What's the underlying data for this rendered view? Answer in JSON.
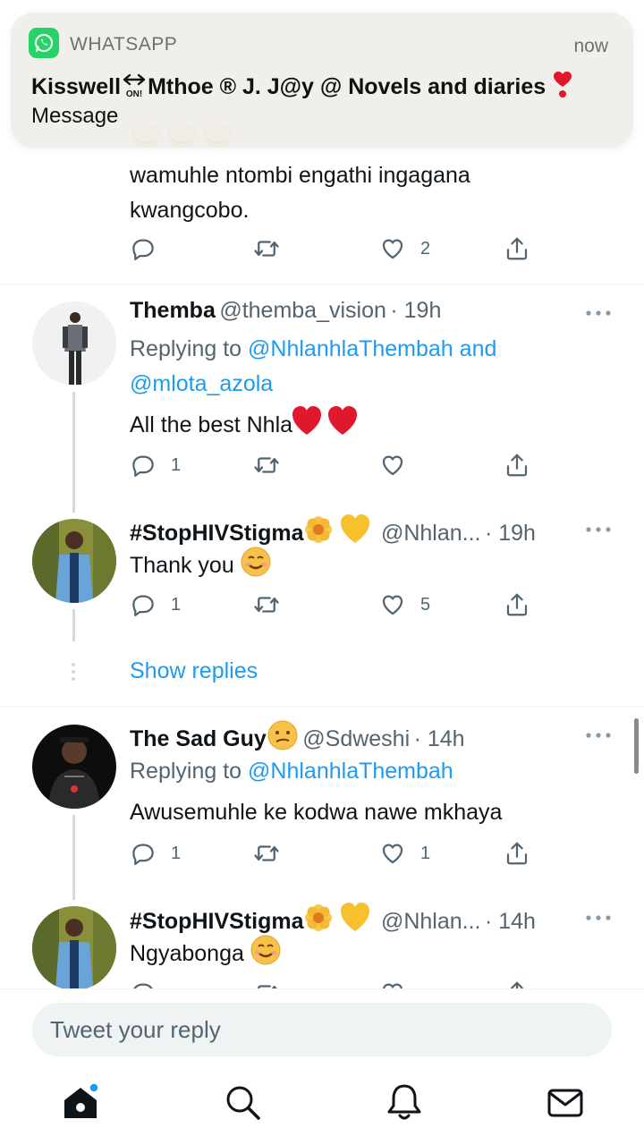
{
  "notification": {
    "app": "WHATSAPP",
    "time": "now",
    "title_a": "Kisswell",
    "title_badge": "ON!",
    "title_b": "Mthoe ® J. J@y @ Novels and diaries",
    "title_emoji": "❣️",
    "message": "Message"
  },
  "tweet0": {
    "text_line1": "wamuhle ntombi engathi ingagana",
    "text_line2": "kwangcobo.",
    "likes": "2"
  },
  "tweet1": {
    "name": "Themba",
    "handle": "@themba_vision",
    "time": "· 19h",
    "replying_prefix": "Replying to",
    "replying_a": "@NhlanhlaThembah",
    "replying_and": "and",
    "replying_b": "@mlota_azola",
    "text": "All the best Nhla",
    "text_emojis": "❤️ ❤️",
    "replies": "1"
  },
  "tweet2": {
    "name": "#StopHIVStigma",
    "name_emojis": "🌼💛",
    "handle": "@Nhlan...",
    "time": "· 19h",
    "text": "Thank you",
    "text_emoji": "😊",
    "replies": "1",
    "likes": "5"
  },
  "show_replies": "Show replies",
  "tweet3": {
    "name": "The Sad Guy",
    "name_emoji": "😕",
    "handle": "@Sdweshi",
    "time": "· 14h",
    "replying_prefix": "Replying to",
    "replying_a": "@NhlanhlaThembah",
    "text": "Awusemuhle ke kodwa nawe mkhaya",
    "replies": "1",
    "likes": "1"
  },
  "tweet4": {
    "name": "#StopHIVStigma",
    "name_emojis": "🌼💛",
    "handle": "@Nhlan...",
    "time": "· 14h",
    "text": "Ngyabonga",
    "text_emoji": "😊"
  },
  "composer": {
    "placeholder": "Tweet your reply"
  },
  "colors": {
    "accent": "#1d9bf0",
    "whatsapp": "#25d366",
    "muted": "#536471"
  }
}
